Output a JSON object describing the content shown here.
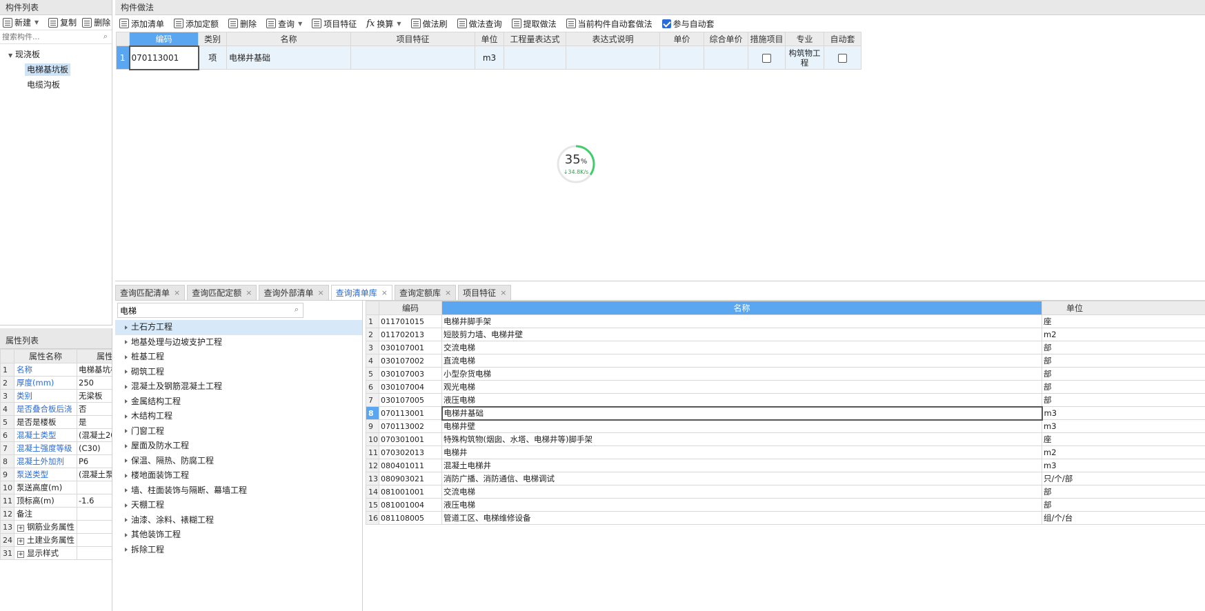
{
  "left_panel": {
    "title": "构件列表",
    "toolbar": {
      "new": "新建",
      "copy": "复制",
      "delete": "删除"
    },
    "search_placeholder": "搜索构件...",
    "tree": {
      "root": "现浇板",
      "items": [
        "电梯基坑板",
        "电缆沟板"
      ]
    }
  },
  "props_panel": {
    "title": "属性列表",
    "headers": [
      "属性名称",
      "属性"
    ],
    "rows": [
      {
        "n": "1",
        "name": "名称",
        "value": "电梯基坑板",
        "link": true
      },
      {
        "n": "2",
        "name": "厚度(mm)",
        "value": "250",
        "link": true
      },
      {
        "n": "3",
        "name": "类别",
        "value": "无梁板",
        "link": true
      },
      {
        "n": "4",
        "name": "是否叠合板后浇",
        "value": "否",
        "link": true
      },
      {
        "n": "5",
        "name": "是否是楼板",
        "value": "是",
        "link": false
      },
      {
        "n": "6",
        "name": "混凝土类型",
        "value": "(混凝土20",
        "link": true
      },
      {
        "n": "7",
        "name": "混凝土强度等级",
        "value": "(C30)",
        "link": true
      },
      {
        "n": "8",
        "name": "混凝土外加剂",
        "value": "P6",
        "link": true
      },
      {
        "n": "9",
        "name": "泵送类型",
        "value": "(混凝土泵)",
        "link": true
      },
      {
        "n": "10",
        "name": "泵送高度(m)",
        "value": "",
        "link": false
      },
      {
        "n": "11",
        "name": "顶标高(m)",
        "value": "-1.6",
        "link": false
      },
      {
        "n": "12",
        "name": "备注",
        "value": "",
        "link": false
      },
      {
        "n": "13",
        "name": "钢筋业务属性",
        "value": "",
        "link": false,
        "expand": true
      },
      {
        "n": "24",
        "name": "土建业务属性",
        "value": "",
        "link": false,
        "expand": true
      },
      {
        "n": "31",
        "name": "显示样式",
        "value": "",
        "link": false,
        "expand": true
      }
    ]
  },
  "method_panel": {
    "title": "构件做法",
    "toolbar": {
      "add_list": "添加清单",
      "add_quota": "添加定额",
      "delete": "删除",
      "query": "查询",
      "item_feature": "项目特征",
      "convert": "换算",
      "method_brush": "做法刷",
      "method_query": "做法查询",
      "extract": "提取做法",
      "auto_method": "当前构件自动套做法",
      "auto_join": "参与自动套"
    },
    "headers": [
      "编码",
      "类别",
      "名称",
      "项目特征",
      "单位",
      "工程量表达式",
      "表达式说明",
      "单价",
      "综合单价",
      "措施项目",
      "专业",
      "自动套"
    ],
    "row": {
      "n": "1",
      "code": "070113001",
      "type": "项",
      "name": "电梯井基础",
      "feature": "",
      "unit": "m3",
      "expr": "",
      "expr_desc": "",
      "price": "",
      "total_price": "",
      "specialty": "构筑物工程"
    }
  },
  "progress": {
    "percent": "35",
    "percent_sign": "%",
    "speed": "34.8K/s",
    "value": 0.35
  },
  "bottom_tabs": [
    "查询匹配清单",
    "查询匹配定额",
    "查询外部清单",
    "查询清单库",
    "查询定额库",
    "项目特征"
  ],
  "bottom_tabs_active": 3,
  "library": {
    "search_value": "电梯",
    "tree": [
      "土石方工程",
      "地基处理与边坡支护工程",
      "桩基工程",
      "砌筑工程",
      "混凝土及钢筋混凝土工程",
      "金属结构工程",
      "木结构工程",
      "门窗工程",
      "屋面及防水工程",
      "保温、隔热、防腐工程",
      "楼地面装饰工程",
      "墙、柱面装饰与隔断、幕墙工程",
      "天棚工程",
      "油漆、涂料、裱糊工程",
      "其他装饰工程",
      "拆除工程"
    ]
  },
  "results": {
    "headers": [
      "编码",
      "名称",
      "单位"
    ],
    "selected": 8,
    "rows": [
      {
        "n": "1",
        "code": "011701015",
        "name": "电梯井脚手架",
        "unit": "座"
      },
      {
        "n": "2",
        "code": "011702013",
        "name": "短肢剪力墙、电梯井壁",
        "unit": "m2"
      },
      {
        "n": "3",
        "code": "030107001",
        "name": "交流电梯",
        "unit": "部"
      },
      {
        "n": "4",
        "code": "030107002",
        "name": "直流电梯",
        "unit": "部"
      },
      {
        "n": "5",
        "code": "030107003",
        "name": "小型杂货电梯",
        "unit": "部"
      },
      {
        "n": "6",
        "code": "030107004",
        "name": "观光电梯",
        "unit": "部"
      },
      {
        "n": "7",
        "code": "030107005",
        "name": "液压电梯",
        "unit": "部"
      },
      {
        "n": "8",
        "code": "070113001",
        "name": "电梯井基础",
        "unit": "m3"
      },
      {
        "n": "9",
        "code": "070113002",
        "name": "电梯井壁",
        "unit": "m3"
      },
      {
        "n": "10",
        "code": "070301001",
        "name": "特殊构筑物(烟囱、水塔、电梯井等)脚手架",
        "unit": "座"
      },
      {
        "n": "11",
        "code": "070302013",
        "name": "电梯井",
        "unit": "m2"
      },
      {
        "n": "12",
        "code": "080401011",
        "name": "混凝土电梯井",
        "unit": "m3"
      },
      {
        "n": "13",
        "code": "080903021",
        "name": "消防广播、消防通信、电梯调试",
        "unit": "只/个/部"
      },
      {
        "n": "14",
        "code": "081001001",
        "name": "交流电梯",
        "unit": "部"
      },
      {
        "n": "15",
        "code": "081001004",
        "name": "液压电梯",
        "unit": "部"
      },
      {
        "n": "16",
        "code": "081108005",
        "name": "管道工区、电梯维修设备",
        "unit": "组/个/台"
      }
    ]
  }
}
